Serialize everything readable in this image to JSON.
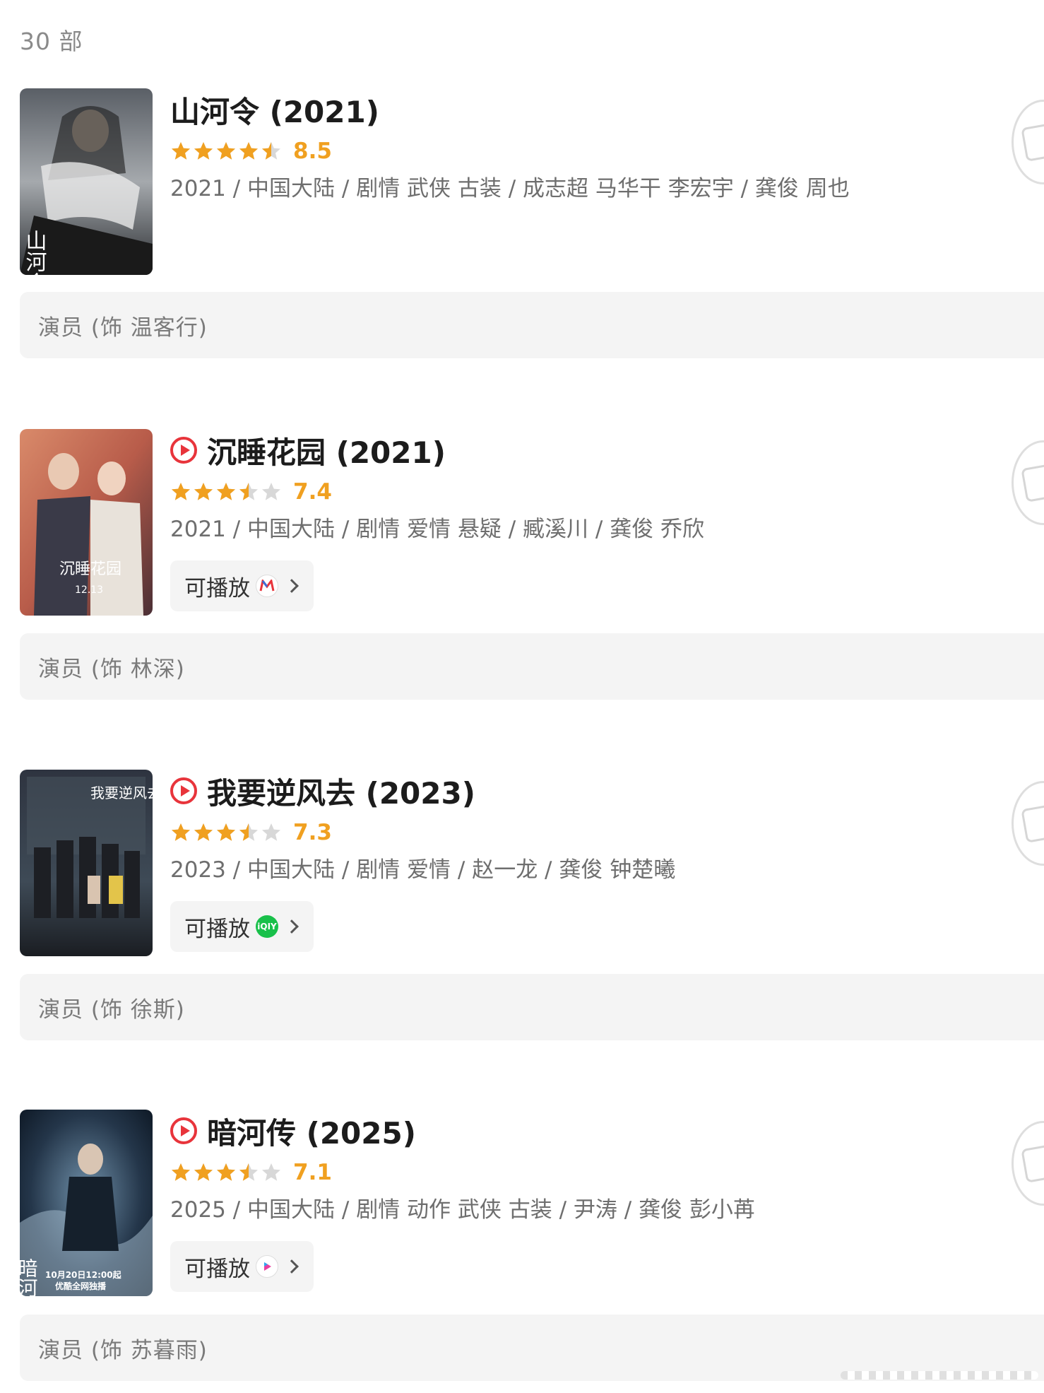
{
  "header": {
    "count": "30 部"
  },
  "items": [
    {
      "title": "山河令 (2021)",
      "has_play_mark": false,
      "rating": 4.5,
      "score": "8.5",
      "meta": "2021 / 中国大陆 / 剧情 武侠 古装 / 成志超 马华干 李宏宇 / 龚俊 周也",
      "play": null,
      "role": "演员 (饰 温客行)",
      "poster_caption": "山河令"
    },
    {
      "title": "沉睡花园 (2021)",
      "has_play_mark": true,
      "rating": 3.5,
      "score": "7.4",
      "meta": "2021 / 中国大陆 / 剧情 爱情 悬疑 / 臧溪川 / 龚俊 乔欣",
      "play": {
        "label": "可播放",
        "platform_icon": "mango-tv-icon"
      },
      "role": "演员 (饰 林深)",
      "poster_caption": "沉睡花园",
      "poster_date": "12.13"
    },
    {
      "title": "我要逆风去 (2023)",
      "has_play_mark": true,
      "rating": 3.5,
      "score": "7.3",
      "meta": "2023 / 中国大陆 / 剧情 爱情 / 赵一龙 / 龚俊 钟楚曦",
      "play": {
        "label": "可播放",
        "platform_icon": "iqiyi-icon"
      },
      "role": "演员 (饰 徐斯)",
      "poster_caption": "我要逆风去"
    },
    {
      "title": "暗河传 (2025)",
      "has_play_mark": true,
      "rating": 3.5,
      "score": "7.1",
      "meta": "2025 / 中国大陆 / 剧情 动作 武侠 古装 / 尹涛 / 龚俊 彭小苒",
      "play": {
        "label": "可播放",
        "platform_icon": "youku-icon"
      },
      "role": "演员 (饰 苏暮雨)",
      "poster_caption": "暗河传",
      "poster_date": "10月20日12:00起",
      "poster_note": "优酷全网独播"
    }
  ],
  "colors": {
    "star": "#f0a020",
    "star_empty": "#d8d8d8",
    "play_mark": "#e8343b"
  }
}
